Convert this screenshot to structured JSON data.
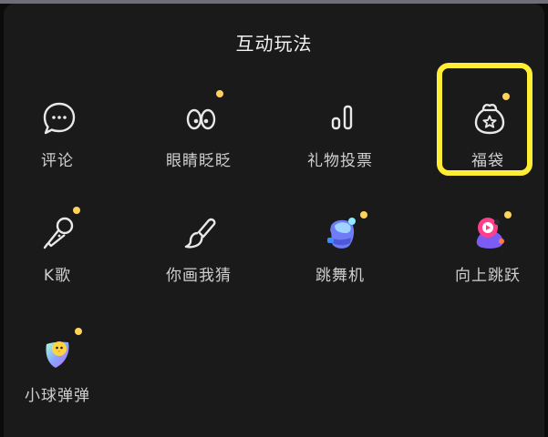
{
  "panel": {
    "title": "互动玩法"
  },
  "items": [
    {
      "label": "评论",
      "icon": "comment-icon",
      "badge": false
    },
    {
      "label": "眼睛眨眨",
      "icon": "eyes-icon",
      "badge": true
    },
    {
      "label": "礼物投票",
      "icon": "bar-vote-icon",
      "badge": false
    },
    {
      "label": "福袋",
      "icon": "lucky-bag-icon",
      "badge": true,
      "highlighted": true
    },
    {
      "label": "K歌",
      "icon": "microphone-icon",
      "badge": true
    },
    {
      "label": "你画我猜",
      "icon": "brush-icon",
      "badge": false
    },
    {
      "label": "跳舞机",
      "icon": "dance-machine-icon",
      "badge": true
    },
    {
      "label": "向上跳跃",
      "icon": "jump-up-icon",
      "badge": true
    },
    {
      "label": "小球弹弹",
      "icon": "bouncing-ball-icon",
      "badge": true
    }
  ],
  "colors": {
    "badge": "#ffd35a",
    "highlight": "#ffee33",
    "panel": "#1a1a1a"
  }
}
